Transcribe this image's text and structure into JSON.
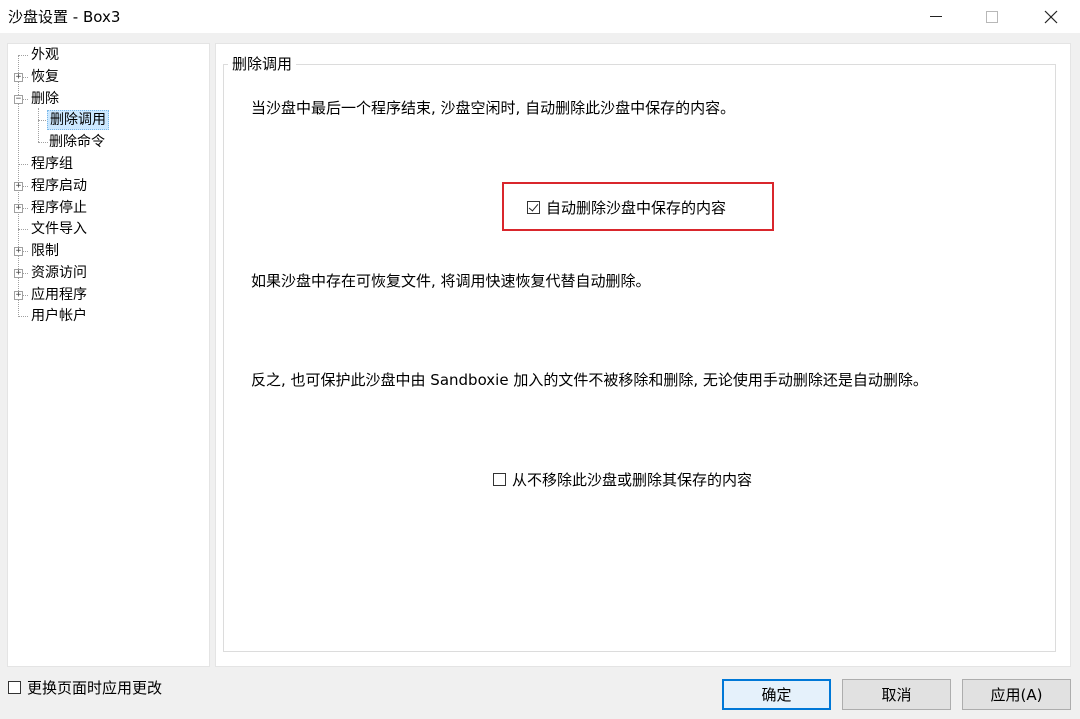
{
  "window": {
    "title": "沙盘设置 - Box3"
  },
  "tree": {
    "items": [
      {
        "label": "外观",
        "expander": ""
      },
      {
        "label": "恢复",
        "expander": "+"
      },
      {
        "label": "删除",
        "expander": "−"
      },
      {
        "label": "删除调用",
        "expander": "",
        "selected": true
      },
      {
        "label": "删除命令",
        "expander": ""
      },
      {
        "label": "程序组",
        "expander": ""
      },
      {
        "label": "程序启动",
        "expander": "+"
      },
      {
        "label": "程序停止",
        "expander": "+"
      },
      {
        "label": "文件导入",
        "expander": ""
      },
      {
        "label": "限制",
        "expander": "+"
      },
      {
        "label": "资源访问",
        "expander": "+"
      },
      {
        "label": "应用程序",
        "expander": "+"
      },
      {
        "label": "用户帐户",
        "expander": ""
      }
    ]
  },
  "content": {
    "group_title": "删除调用",
    "desc1": "当沙盘中最后一个程序结束, 沙盘空闲时, 自动删除此沙盘中保存的内容。",
    "auto_delete_checkbox": {
      "label": "自动删除沙盘中保存的内容",
      "checked": true
    },
    "desc2": "如果沙盘中存在可恢复文件, 将调用快速恢复代替自动删除。",
    "desc3": "反之, 也可保护此沙盘中由 Sandboxie 加入的文件不被移除和删除, 无论使用手动删除还是自动删除。",
    "never_delete_checkbox": {
      "label": "从不移除此沙盘或删除其保存的内容",
      "checked": false
    },
    "highlight_color": "#d9262c"
  },
  "footer": {
    "apply_on_switch_checkbox": {
      "label": "更换页面时应用更改",
      "checked": false
    },
    "ok_label": "确定",
    "cancel_label": "取消",
    "apply_label": "应用(A)"
  }
}
